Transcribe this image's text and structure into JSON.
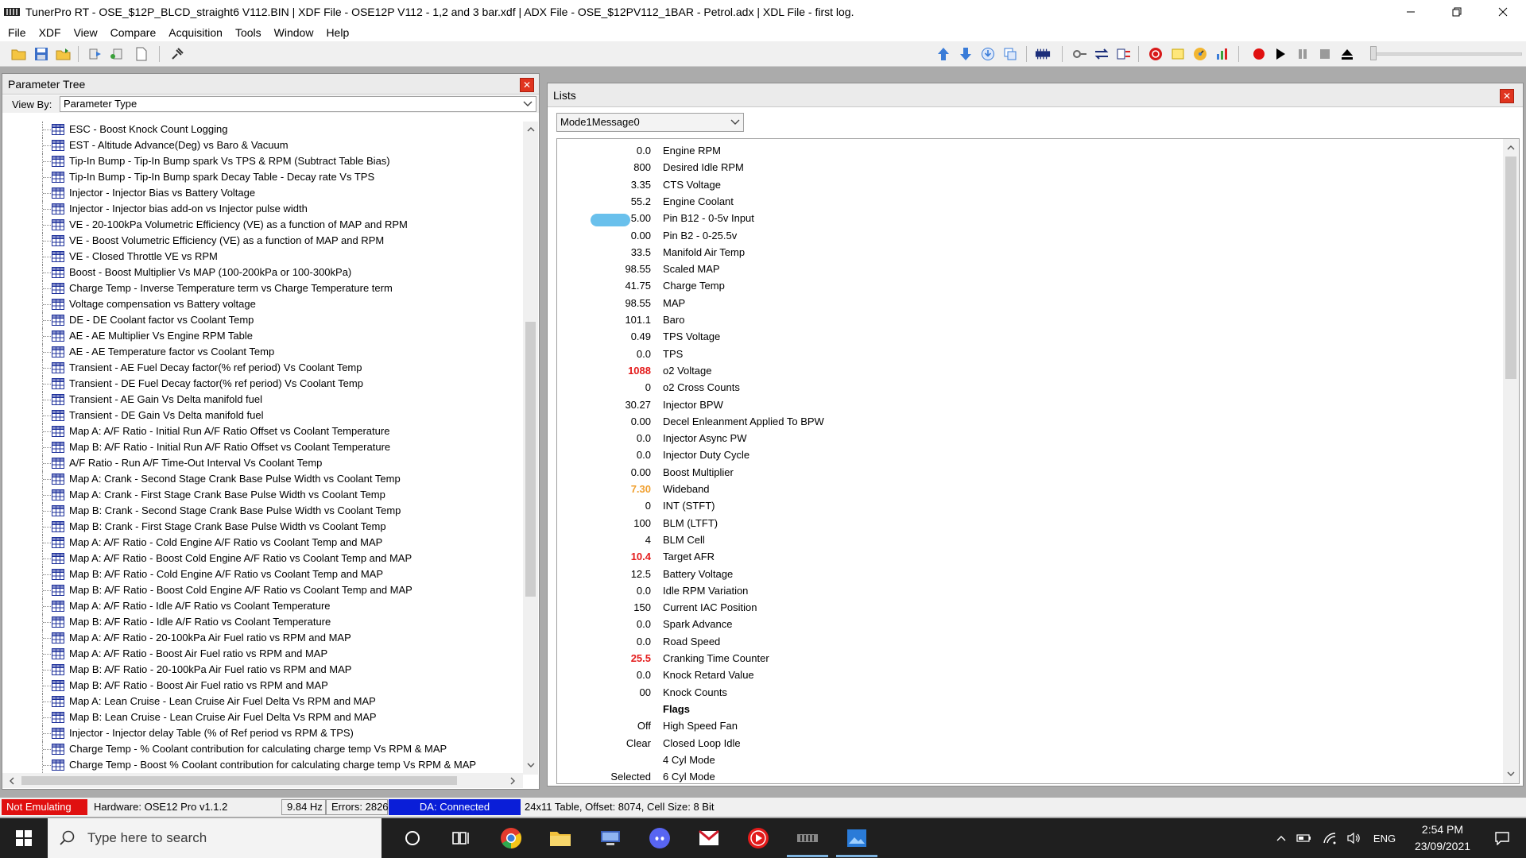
{
  "window": {
    "title": "TunerPro RT - OSE_$12P_BLCD_straight6 V112.BIN | XDF File - OSE12P V112 - 1,2 and 3 bar.xdf | ADX File - OSE_$12PV112_1BAR - Petrol.adx | XDL File - first log."
  },
  "menu": [
    "File",
    "XDF",
    "View",
    "Compare",
    "Acquisition",
    "Tools",
    "Window",
    "Help"
  ],
  "parameter_tree": {
    "title": "Parameter Tree",
    "view_by_label": "View By:",
    "view_by_value": "Parameter Type",
    "items": [
      "ESC - Boost Knock Count Logging",
      "EST - Altitude Advance(Deg) vs Baro & Vacuum",
      "Tip-In Bump - Tip-In Bump spark Vs TPS & RPM  (Subtract Table Bias)",
      "Tip-In Bump - Tip-In Bump spark Decay Table - Decay rate Vs TPS",
      "Injector - Injector Bias vs Battery Voltage",
      "Injector - Injector bias add-on vs Injector pulse width",
      "VE - 20-100kPa Volumetric Efficiency (VE) as a function of MAP and RPM",
      "VE - Boost Volumetric Efficiency (VE) as a function of MAP and RPM",
      "VE - Closed Throttle VE vs RPM",
      "Boost - Boost Multiplier Vs MAP (100-200kPa or 100-300kPa)",
      "Charge Temp - Inverse Temperature term vs Charge Temperature term",
      "Voltage compensation vs Battery voltage",
      "DE - DE Coolant factor vs Coolant Temp",
      "AE - AE Multiplier Vs Engine RPM Table",
      "AE - AE Temperature factor vs Coolant Temp",
      "Transient - AE Fuel Decay factor(% ref period)  Vs Coolant Temp",
      "Transient - DE Fuel Decay factor(% ref period)  Vs Coolant Temp",
      "Transient - AE Gain Vs Delta manifold fuel",
      "Transient - DE Gain Vs Delta manifold fuel",
      "Map A: A/F Ratio - Initial Run A/F Ratio Offset vs Coolant Temperature",
      "Map B: A/F Ratio - Initial Run A/F Ratio Offset vs Coolant Temperature",
      "A/F Ratio - Run A/F Time-Out Interval Vs Coolant Temp",
      "Map A: Crank - Second Stage Crank Base Pulse Width vs Coolant Temp",
      "Map A: Crank - First Stage Crank Base Pulse Width vs Coolant Temp",
      "Map B: Crank - Second Stage Crank Base Pulse Width vs Coolant Temp",
      "Map B: Crank - First Stage Crank Base Pulse Width vs Coolant Temp",
      "Map A: A/F Ratio - Cold Engine A/F Ratio vs Coolant Temp and MAP",
      "Map A: A/F Ratio - Boost Cold Engine A/F Ratio vs Coolant Temp and MAP",
      "Map B: A/F Ratio - Cold Engine A/F Ratio vs Coolant Temp and MAP",
      "Map B: A/F Ratio - Boost Cold Engine A/F Ratio vs Coolant Temp and MAP",
      "Map A: A/F Ratio - Idle A/F Ratio vs Coolant Temperature",
      "Map B: A/F Ratio - Idle A/F Ratio vs Coolant Temperature",
      "Map A: A/F Ratio - 20-100kPa Air Fuel ratio vs RPM and MAP",
      "Map A: A/F Ratio - Boost Air Fuel ratio vs RPM and MAP",
      "Map B: A/F Ratio - 20-100kPa Air Fuel ratio vs RPM and MAP",
      "Map B: A/F Ratio - Boost Air Fuel ratio vs RPM and MAP",
      "Map A: Lean Cruise - Lean Cruise Air Fuel Delta Vs RPM and MAP",
      "Map B: Lean Cruise - Lean Cruise Air Fuel Delta Vs RPM and MAP",
      "Injector - Injector delay Table (% of Ref period vs RPM & TPS)",
      "Charge Temp - % Coolant contribution for calculating charge temp Vs RPM & MAP",
      "Charge Temp - Boost % Coolant contribution for calculating charge temp Vs RPM & MAP"
    ]
  },
  "lists": {
    "title": "Lists",
    "selector_value": "Mode1Message0",
    "rows": [
      {
        "value": "0.0",
        "name": "Engine RPM",
        "style": ""
      },
      {
        "value": "800",
        "name": "Desired Idle RPM",
        "style": ""
      },
      {
        "value": "3.35",
        "name": "CTS Voltage",
        "style": ""
      },
      {
        "value": "55.2",
        "name": "Engine Coolant",
        "style": ""
      },
      {
        "value": "5.00",
        "name": "Pin B12 - 0-5v Input",
        "style": ""
      },
      {
        "value": "0.00",
        "name": "Pin B2 - 0-25.5v",
        "style": ""
      },
      {
        "value": "33.5",
        "name": "Manifold Air Temp",
        "style": ""
      },
      {
        "value": "98.55",
        "name": "Scaled MAP",
        "style": ""
      },
      {
        "value": "41.75",
        "name": "Charge Temp",
        "style": ""
      },
      {
        "value": "98.55",
        "name": "MAP",
        "style": ""
      },
      {
        "value": "101.1",
        "name": "Baro",
        "style": ""
      },
      {
        "value": "0.49",
        "name": "TPS Voltage",
        "style": ""
      },
      {
        "value": "0.0",
        "name": "TPS",
        "style": ""
      },
      {
        "value": "1088",
        "name": "o2 Voltage",
        "style": "red"
      },
      {
        "value": "0",
        "name": "o2 Cross Counts",
        "style": ""
      },
      {
        "value": "30.27",
        "name": "Injector BPW",
        "style": ""
      },
      {
        "value": "0.00",
        "name": "Decel Enleanment Applied To BPW",
        "style": ""
      },
      {
        "value": "0.0",
        "name": "Injector Async PW",
        "style": ""
      },
      {
        "value": "0.0",
        "name": "Injector Duty Cycle",
        "style": ""
      },
      {
        "value": "0.00",
        "name": "Boost Multiplier",
        "style": ""
      },
      {
        "value": "7.30",
        "name": "Wideband",
        "style": "orange"
      },
      {
        "value": "0",
        "name": "INT (STFT)",
        "style": ""
      },
      {
        "value": "100",
        "name": "BLM (LTFT)",
        "style": ""
      },
      {
        "value": "4",
        "name": "BLM Cell",
        "style": ""
      },
      {
        "value": "10.4",
        "name": "Target AFR",
        "style": "red"
      },
      {
        "value": "12.5",
        "name": "Battery Voltage",
        "style": ""
      },
      {
        "value": "0.0",
        "name": "Idle RPM Variation",
        "style": ""
      },
      {
        "value": "150",
        "name": "Current IAC Position",
        "style": ""
      },
      {
        "value": "0.0",
        "name": "Spark Advance",
        "style": ""
      },
      {
        "value": "0.0",
        "name": "Road Speed",
        "style": ""
      },
      {
        "value": "25.5",
        "name": "Cranking Time Counter",
        "style": "red"
      },
      {
        "value": "0.0",
        "name": "Knock Retard Value",
        "style": ""
      },
      {
        "value": "00",
        "name": "Knock Counts",
        "style": ""
      },
      {
        "value": "",
        "name": "Flags",
        "style": "heading"
      },
      {
        "value": "Off",
        "name": "High Speed Fan",
        "style": ""
      },
      {
        "value": "Clear",
        "name": "Closed Loop Idle",
        "style": ""
      },
      {
        "value": "",
        "name": "4 Cyl Mode",
        "style": ""
      },
      {
        "value": "Selected",
        "name": "6 Cyl Mode",
        "style": ""
      }
    ]
  },
  "status_bar": {
    "emulation": "Not Emulating",
    "hardware": "Hardware: OSE12 Pro v1.1.2",
    "rate": "9.84 Hz",
    "errors": "Errors: 2826",
    "da": "DA: Connected",
    "table_info": "24x11 Table, Offset: 8074,  Cell Size: 8 Bit"
  },
  "taskbar": {
    "search_placeholder": "Type here to search",
    "language": "ENG",
    "time": "2:54 PM",
    "date": "23/09/2021"
  },
  "colors": {
    "accent_blue": "#0a1ed8",
    "status_red": "#e01010",
    "value_red": "#e41c1c",
    "value_orange": "#f0a030",
    "close_red": "#e0341f"
  }
}
